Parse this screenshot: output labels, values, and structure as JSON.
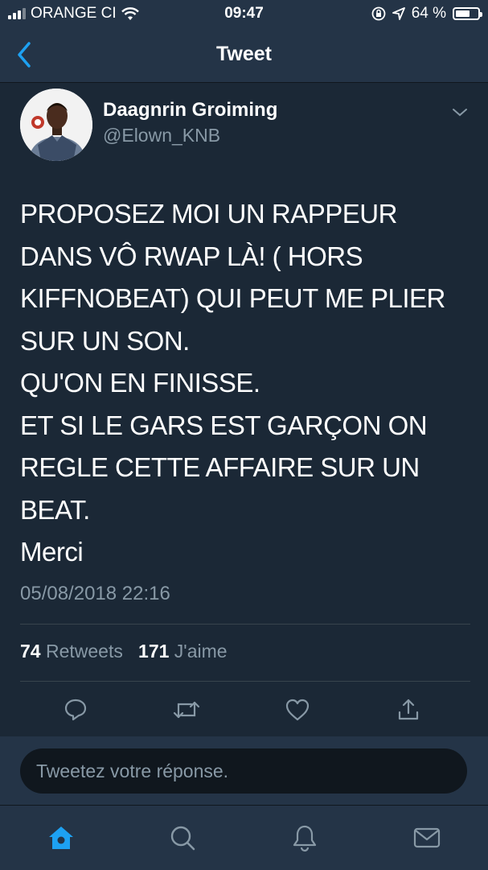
{
  "status_bar": {
    "carrier": "ORANGE CI",
    "time": "09:47",
    "battery": "64 %",
    "battery_level": 0.64
  },
  "nav": {
    "title": "Tweet"
  },
  "tweet": {
    "author_name": "Daagnrin Groiming",
    "author_handle": "@Elown_KNB",
    "text_lines": [
      "PROPOSEZ MOI UN RAPPEUR",
      "DANS VÔ RWAP LÀ! ( HORS",
      "KIFFNOBEAT) QUI PEUT ME PLIER",
      "SUR UN SON.",
      "QU'ON EN FINISSE.",
      "ET SI LE GARS EST GARÇON ON",
      "REGLE CETTE AFFAIRE SUR UN",
      "BEAT.",
      "Merci"
    ],
    "timestamp": "05/08/2018 22:16",
    "retweets_count": "74",
    "retweets_label": "Retweets",
    "likes_count": "171",
    "likes_label": "J'aime"
  },
  "reply": {
    "placeholder": "Tweetez votre réponse."
  },
  "tabs": [
    {
      "icon": "home-icon",
      "active": true
    },
    {
      "icon": "search-icon",
      "active": false
    },
    {
      "icon": "notifications-icon",
      "active": false
    },
    {
      "icon": "messages-icon",
      "active": false
    }
  ],
  "colors": {
    "background": "#1b2836",
    "bar": "#243447",
    "accent": "#1da1f2",
    "secondary_text": "#8899a6"
  }
}
